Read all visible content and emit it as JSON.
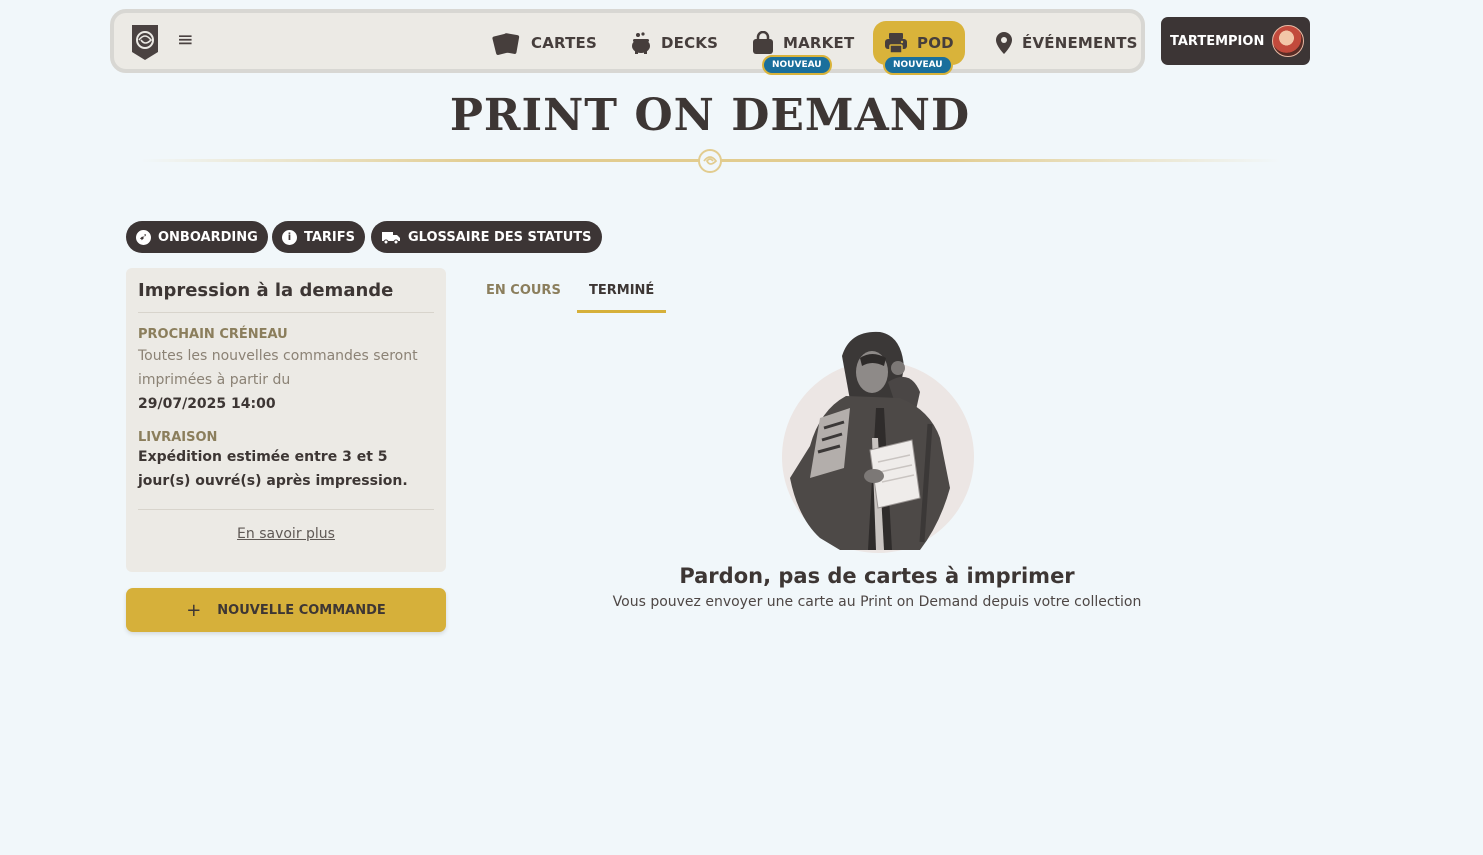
{
  "nav": {
    "items": [
      {
        "label": "CARTES",
        "icon": "cards-icon"
      },
      {
        "label": "DECKS",
        "icon": "cauldron-icon"
      },
      {
        "label": "MARKET",
        "icon": "shopping-bag-icon",
        "badge": "NOUVEAU"
      },
      {
        "label": "POD",
        "icon": "printer-icon",
        "badge": "NOUVEAU",
        "active": true
      },
      {
        "label": "ÉVÉNEMENTS",
        "icon": "map-pin-icon"
      }
    ],
    "menu_icon": "≡",
    "user": {
      "name": "TARTEMPION"
    }
  },
  "page": {
    "title": "PRINT ON DEMAND"
  },
  "pills": [
    {
      "label": "ONBOARDING",
      "icon": "compass-icon"
    },
    {
      "label": "TARIFS",
      "icon": "info-icon"
    },
    {
      "label": "GLOSSAIRE DES STATUTS",
      "icon": "truck-icon"
    }
  ],
  "card": {
    "title": "Impression à la demande",
    "slot_label": "PROCHAIN CRÉNEAU",
    "slot_text": "Toutes les nouvelles commandes seront imprimées à partir du",
    "slot_date": "29/07/2025 14:00",
    "delivery_label": "LIVRAISON",
    "delivery_text": "Expédition estimée entre 3 et 5 jour(s) ouvré(s) après impression.",
    "learn_more": "En savoir plus"
  },
  "new_order": {
    "label": "NOUVELLE COMMANDE",
    "icon": "+"
  },
  "tabs": [
    {
      "label": "EN COURS"
    },
    {
      "label": "TERMINÉ",
      "selected": true
    }
  ],
  "empty_state": {
    "title": "Pardon, pas de cartes à imprimer",
    "subtitle": "Vous pouvez envoyer une carte au Print on Demand depuis votre collection"
  },
  "colors": {
    "background": "#f1f7fa",
    "accent": "#d6b03a",
    "dark": "#3c3535",
    "badge": "#1a6f9c"
  }
}
